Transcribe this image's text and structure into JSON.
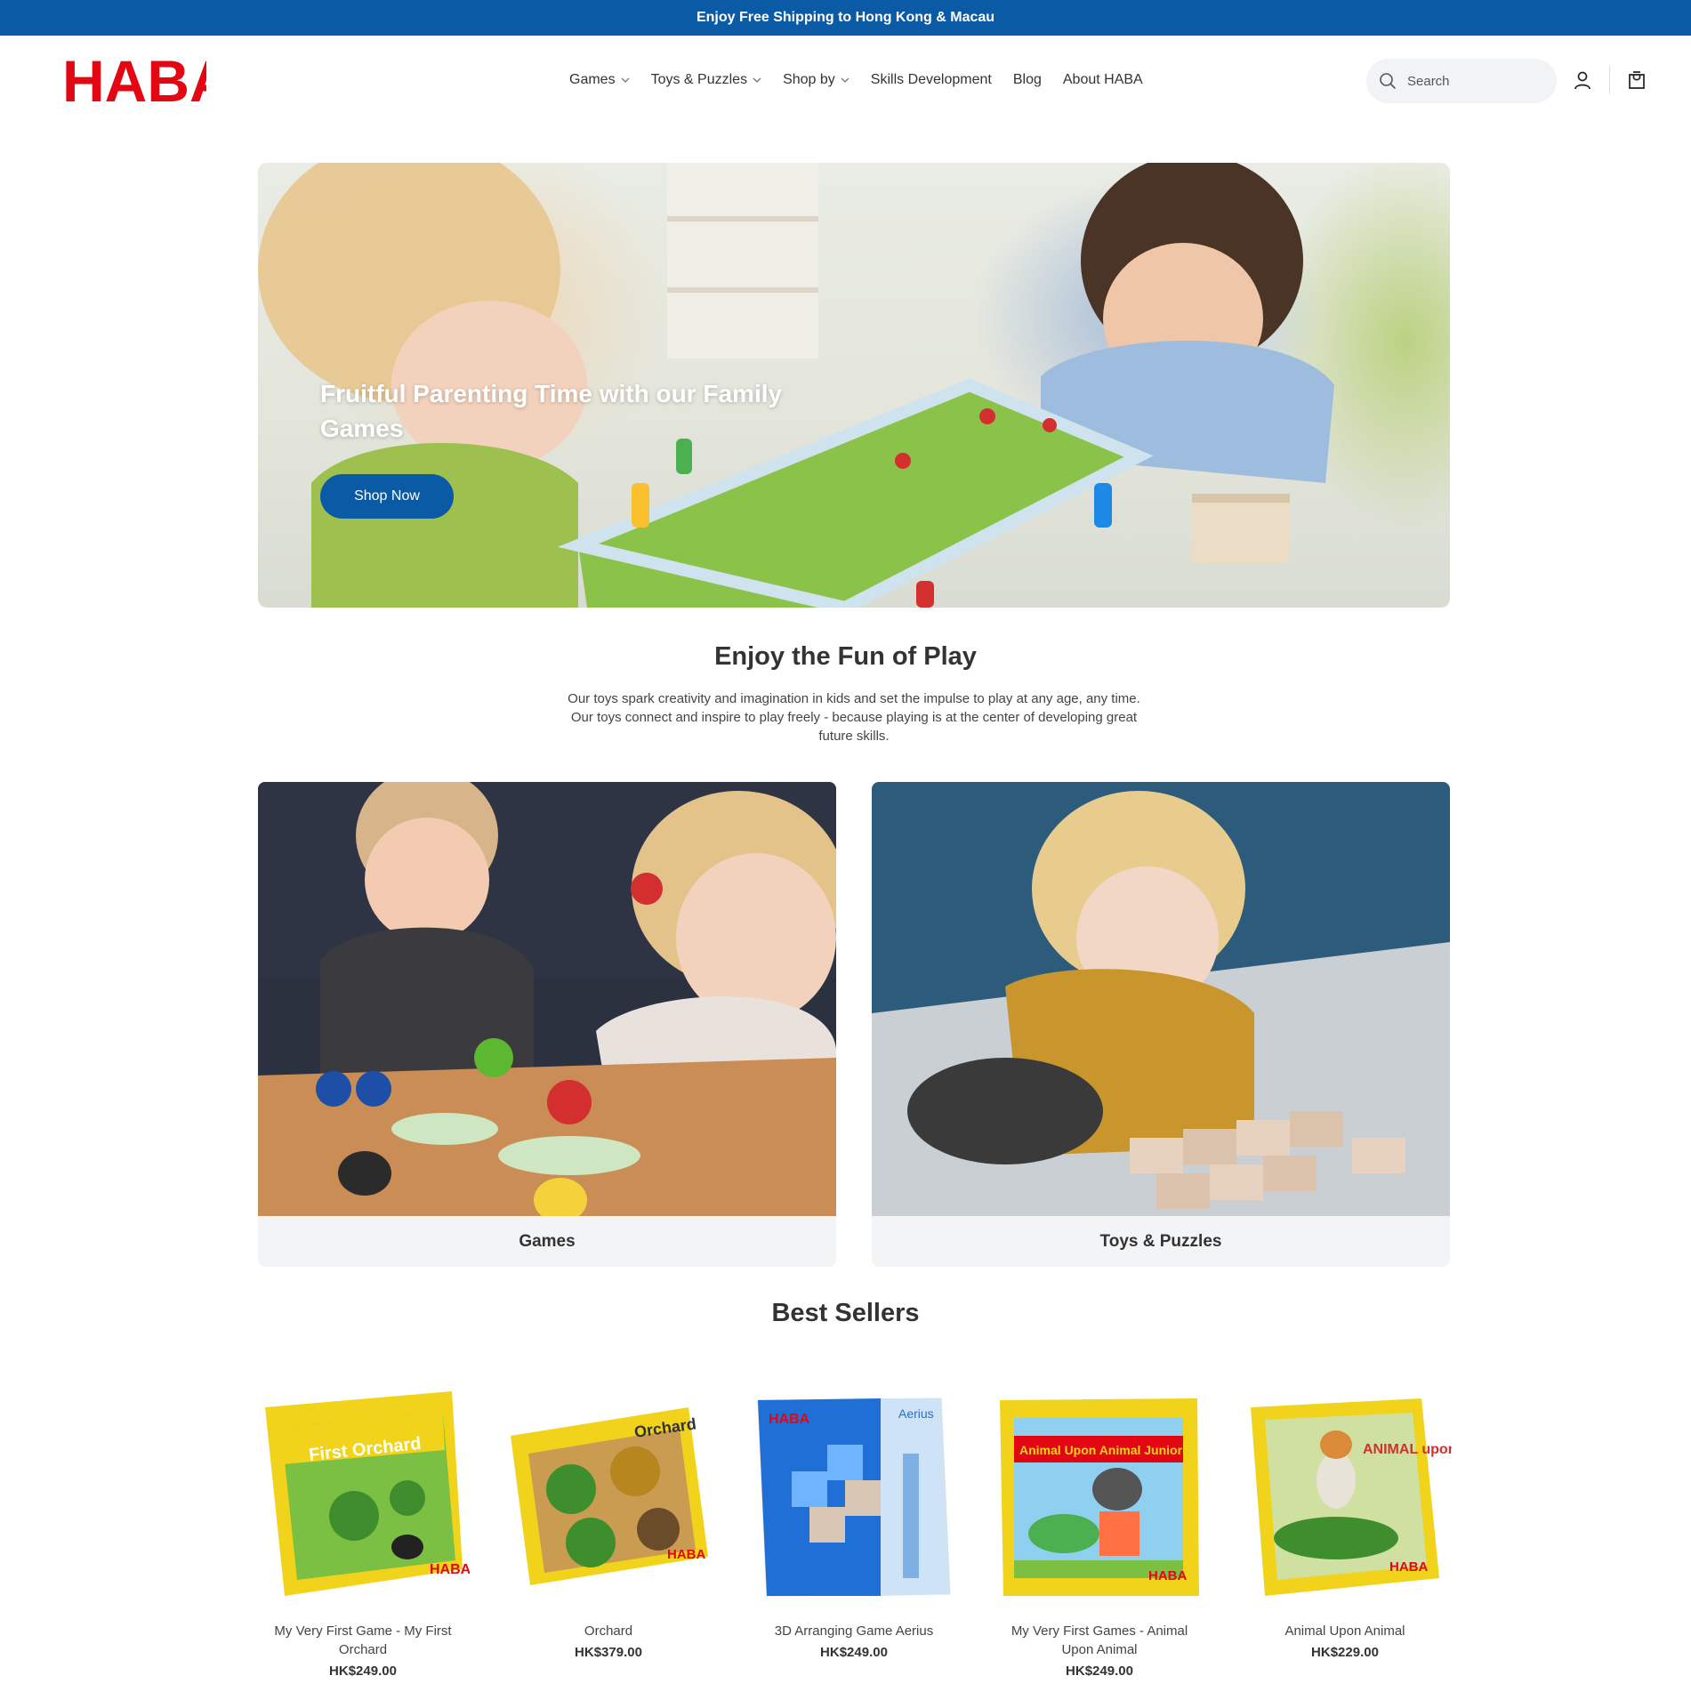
{
  "announcement": "Enjoy Free Shipping to Hong Kong & Macau",
  "brand": {
    "logo_text": "HABA",
    "color": "#e30613"
  },
  "accent_color": "#0b5aa6",
  "nav": [
    {
      "label": "Games",
      "dropdown": true
    },
    {
      "label": "Toys & Puzzles",
      "dropdown": true
    },
    {
      "label": "Shop by",
      "dropdown": true
    },
    {
      "label": "Skills Development",
      "dropdown": false
    },
    {
      "label": "Blog",
      "dropdown": false
    },
    {
      "label": "About HABA",
      "dropdown": false
    }
  ],
  "search": {
    "placeholder": "Search",
    "icon": "search-icon"
  },
  "header_icons": [
    "account-icon",
    "cart-icon"
  ],
  "hero": {
    "title": "Fruitful Parenting Time with our Family Games",
    "button": "Shop Now"
  },
  "intro": {
    "title": "Enjoy the Fun of Play",
    "text": "Our toys spark creativity and imagination in kids and set the impulse to play at any age, any time.  Our toys connect and inspire to play freely - because playing is at the center of developing great future skills."
  },
  "categories": [
    {
      "label": "Games"
    },
    {
      "label": "Toys & Puzzles"
    }
  ],
  "best_sellers": {
    "title": "Best Sellers",
    "products": [
      {
        "name": "My Very First Game - My First Orchard",
        "price": "HK$249.00",
        "box_text": "First Orchard"
      },
      {
        "name": "Orchard",
        "price": "HK$379.00",
        "box_text": "Orchard"
      },
      {
        "name": "3D Arranging Game Aerius",
        "price": "HK$249.00",
        "box_text": "Aerius"
      },
      {
        "name": "My Very First Games - Animal Upon Animal",
        "price": "HK$249.00",
        "box_text": "Animal Upon Animal Junior"
      },
      {
        "name": "Animal Upon Animal",
        "price": "HK$229.00",
        "box_text": "ANIMAL upon ANIMAL"
      }
    ]
  }
}
